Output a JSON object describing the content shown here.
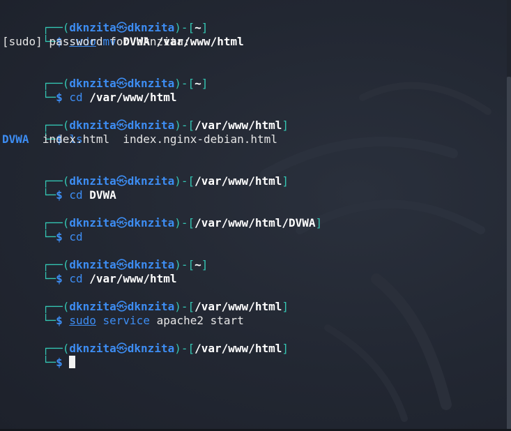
{
  "terminal": {
    "prompt": {
      "open": "┌──(",
      "user": "dknzita",
      "skull": "㉿",
      "host": "dknzita",
      "mid": ")-[",
      "close": "]",
      "second_line": "└─",
      "dollar": "$"
    },
    "blocks": [
      {
        "cwd": "~",
        "command": [
          "sudo",
          "mv"
        ],
        "args": "DVWA /var/www/html",
        "output": "[sudo] password for dknzita:"
      },
      {
        "cwd": "~",
        "command": [
          "cd"
        ],
        "args": "/var/www/html"
      },
      {
        "cwd": "/var/www/html",
        "command": [
          "ls"
        ],
        "output_dir": "DVWA",
        "output_files": "  index.html  index.nginx-debian.html"
      },
      {
        "cwd": "/var/www/html",
        "command": [
          "cd"
        ],
        "args": "DVWA"
      },
      {
        "cwd": "/var/www/html/DVWA",
        "command": [
          "cd"
        ]
      },
      {
        "cwd": "~",
        "command": [
          "cd"
        ],
        "args": "/var/www/html"
      },
      {
        "cwd": "/var/www/html",
        "command": [
          "sudo",
          "service"
        ],
        "args": "apache2 start"
      },
      {
        "cwd": "/var/www/html"
      }
    ]
  },
  "colors": {
    "background": "#232833",
    "frame": "#34c6b3",
    "user": "#3d8df3",
    "text": "#e6e6e6"
  }
}
